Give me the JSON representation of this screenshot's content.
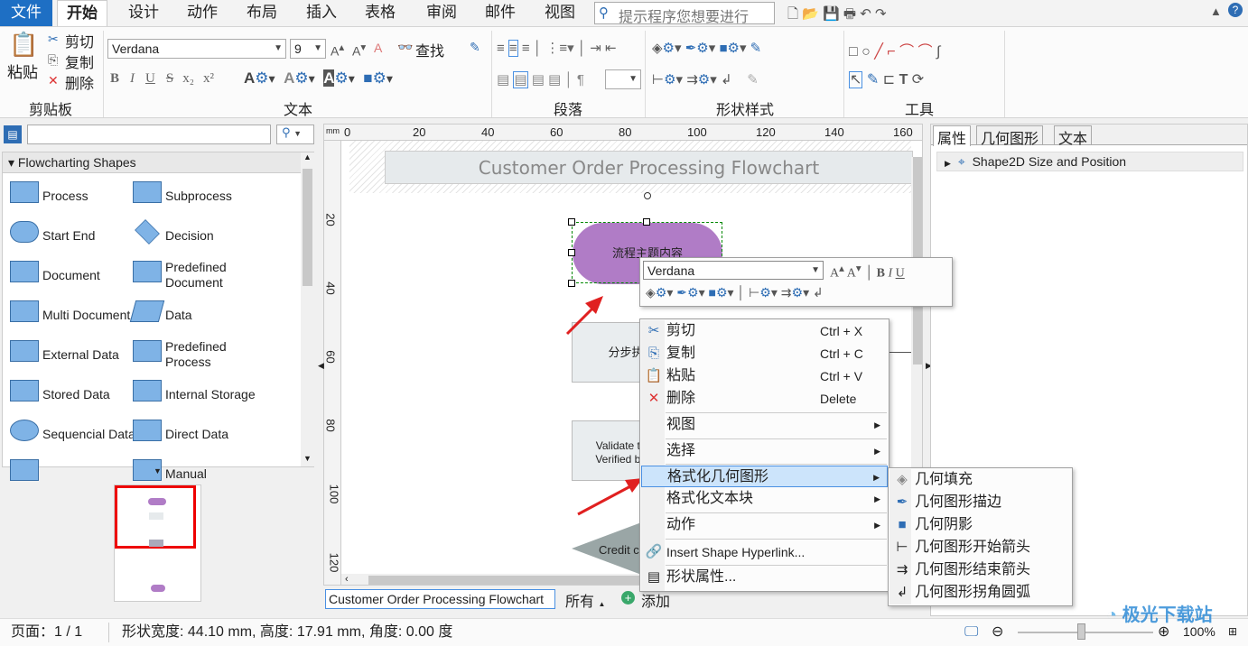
{
  "tabs": [
    "文件",
    "开始",
    "设计",
    "动作",
    "布局",
    "插入",
    "表格",
    "审阅",
    "邮件",
    "视图"
  ],
  "search_placeholder": "提示程序您想要进行",
  "ribbon": {
    "clipboard": {
      "paste": "粘贴",
      "cut": "剪切",
      "copy": "复制",
      "delete": "删除",
      "label": "剪贴板"
    },
    "text": {
      "font": "Verdana",
      "size": "9",
      "find": "查找",
      "label": "文本"
    },
    "paragraph": {
      "label": "段落"
    },
    "shape_style": {
      "label": "形状样式"
    },
    "tools": {
      "label": "工具"
    }
  },
  "left_panel": {
    "search_value": "",
    "shapes_title": "Flowcharting Shapes",
    "shapes": [
      [
        "Process",
        "Subprocess"
      ],
      [
        "Start End",
        "Decision"
      ],
      [
        "Document",
        "Predefined Document"
      ],
      [
        "Multi Document",
        "Data"
      ],
      [
        "External Data",
        "Predefined Process"
      ],
      [
        "Stored Data",
        "Internal Storage"
      ],
      [
        "Sequencial Data",
        "Direct Data"
      ],
      [
        "",
        "Manual"
      ]
    ]
  },
  "ruler": {
    "unit": "mm",
    "top": [
      "0",
      "20",
      "40",
      "60",
      "80",
      "100",
      "120",
      "140",
      "160"
    ],
    "left": [
      "20",
      "40",
      "60",
      "80",
      "100",
      "120"
    ]
  },
  "canvas": {
    "title": "Customer Order Processing Flowchart",
    "start_shape": "流程主题内容",
    "step_shape": "分步执",
    "validate_shape_line1": "Validate thro",
    "validate_shape_line2": "Verified by V",
    "decision_shape": "Credit c"
  },
  "page_tabs": {
    "page": "Customer Order Processing Flowchart",
    "all": "所有",
    "add": "添加"
  },
  "right_panel": {
    "tabs": [
      "属性",
      "几何图形",
      "文本"
    ],
    "row": "Shape2D Size and Position"
  },
  "mini_toolbar": {
    "font": "Verdana"
  },
  "context_menu": [
    {
      "label": "剪切",
      "shortcut": "Ctrl + X",
      "icon": "scissors-icon"
    },
    {
      "label": "复制",
      "shortcut": "Ctrl + C",
      "icon": "copy-icon"
    },
    {
      "label": "粘贴",
      "shortcut": "Ctrl + V",
      "icon": "paste-icon"
    },
    {
      "label": "删除",
      "shortcut": "Delete",
      "icon": "delete-icon"
    },
    {
      "label": "视图"
    },
    {
      "label": "选择"
    },
    {
      "label": "格式化几何图形"
    },
    {
      "label": "格式化文本块"
    },
    {
      "label": "动作"
    },
    {
      "label": "Insert Shape Hyperlink...",
      "icon": "link-icon"
    },
    {
      "label": "形状属性...",
      "icon": "properties-icon"
    }
  ],
  "submenu": [
    "几何填充",
    "几何图形描边",
    "几何阴影",
    "几何图形开始箭头",
    "几何图形结束箭头",
    "几何图形拐角圆弧"
  ],
  "status": {
    "page": "页面：1 / 1",
    "shape_info": "形状宽度: 44.10 mm, 高度: 17.91 mm, 角度: 0.00 度",
    "zoom": "100%",
    "zoom_fraction": 0.5
  },
  "watermark": "极光下载站",
  "colors": {
    "accent": "#1e6fc4",
    "start_shape": "#b07cc6",
    "highlight": "#cce4fb",
    "arrow": "#e02020"
  }
}
